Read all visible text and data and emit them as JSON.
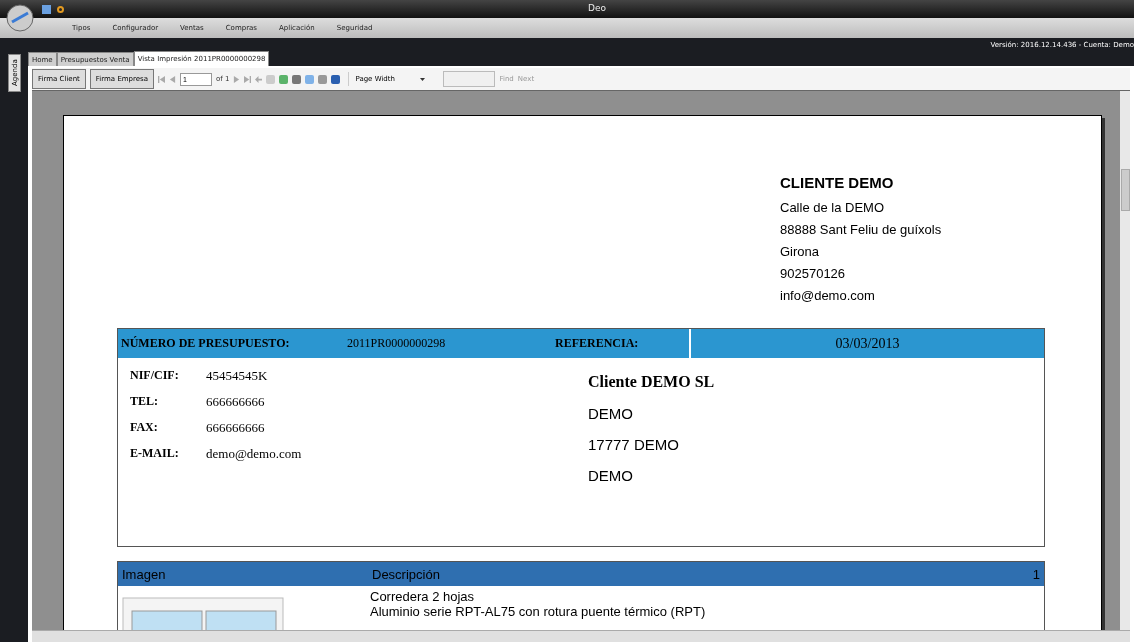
{
  "window": {
    "title": "Deo"
  },
  "menu": [
    "Tipos",
    "Configurador",
    "Ventas",
    "Compras",
    "Aplicación",
    "Seguridad"
  ],
  "version": "Versión: 2016.12.14.436 - Cuenta: Demo",
  "side_tab": "Agenda",
  "tabs": [
    {
      "label": "Home",
      "selected": false
    },
    {
      "label": "Presupuestos Venta",
      "selected": false
    },
    {
      "label": "Vista Impresión 2011PR0000000298",
      "selected": true
    }
  ],
  "toolbar": {
    "buttons": [
      "Firma Client",
      "Firma Empresa"
    ],
    "page": "1",
    "page_of": "of 1",
    "zoom": "Page Width",
    "find": "Find",
    "next": "Next"
  },
  "document": {
    "client": {
      "name": "CLIENTE DEMO",
      "lines": [
        "Calle de la DEMO",
        "88888 Sant Feliu de guíxols",
        "Girona",
        "902570126",
        "info@demo.com"
      ]
    },
    "header": {
      "number_label": "NÚMERO DE PRESUPUESTO:",
      "number": "2011PR0000000298",
      "reference_label": "REFERENCIA:",
      "date": "03/03/2013"
    },
    "contacts": [
      {
        "label": "NIF/CIF:",
        "value": "45454545K"
      },
      {
        "label": "TEL:",
        "value": "666666666"
      },
      {
        "label": "FAX:",
        "value": "666666666"
      },
      {
        "label": "E-MAIL:",
        "value": "demo@demo.com"
      }
    ],
    "company": {
      "name": "Cliente DEMO SL",
      "lines": [
        "DEMO",
        "17777 DEMO",
        "DEMO"
      ]
    },
    "items": {
      "columns": [
        "Imagen",
        "Descripción",
        "1"
      ],
      "rows": [
        {
          "lines": [
            "Corredera 2 hojas",
            "Aluminio serie RPT-AL75 con rotura puente térmico (RPT)"
          ]
        }
      ]
    }
  }
}
